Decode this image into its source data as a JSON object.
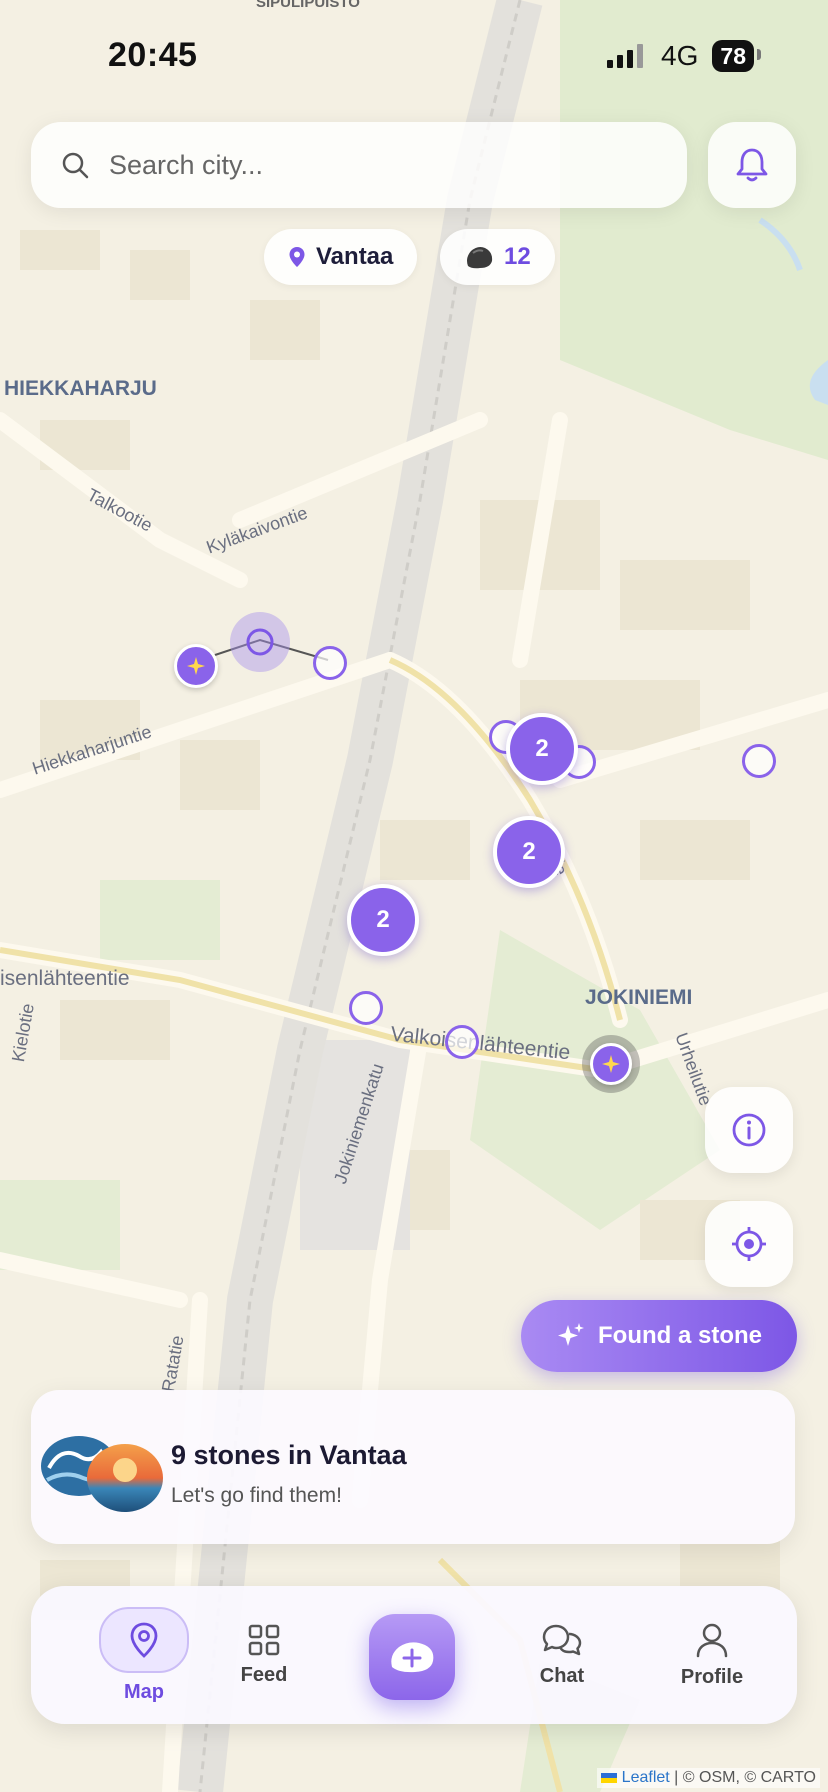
{
  "status_bar": {
    "time": "20:45",
    "network": "4G",
    "battery": "78"
  },
  "search": {
    "placeholder": "Search city..."
  },
  "chips": {
    "city": "Vantaa",
    "stone_count": "12"
  },
  "map_labels": {
    "area_top": "SIPULIPUISTO",
    "district_1": "HIEKKAHARJU",
    "district_2": "JOKINIEMI",
    "street_1": "Talkootie",
    "street_2": "Kyläkaivontie",
    "street_3": "Hiekkaharjuntie",
    "street_4": "isenlähteentie",
    "street_5": "Valkoisenlähteentie",
    "street_6": "Jokiniemenkatu",
    "street_7": "Ratatie",
    "street_8": "Kielotie",
    "street_9": "Urheilutie",
    "street_10": "lutie"
  },
  "clusters": [
    "2",
    "2",
    "2"
  ],
  "actions": {
    "found_stone": "Found a stone"
  },
  "card": {
    "title": "9 stones in Vantaa",
    "subtitle": "Let's go find them!"
  },
  "nav": {
    "map": "Map",
    "feed": "Feed",
    "chat": "Chat",
    "profile": "Profile"
  },
  "attribution": {
    "leaflet": "Leaflet",
    "rest": "| © OSM, © CARTO"
  },
  "colors": {
    "accent": "#8a63ea",
    "accent_dark": "#6e4ce0"
  }
}
